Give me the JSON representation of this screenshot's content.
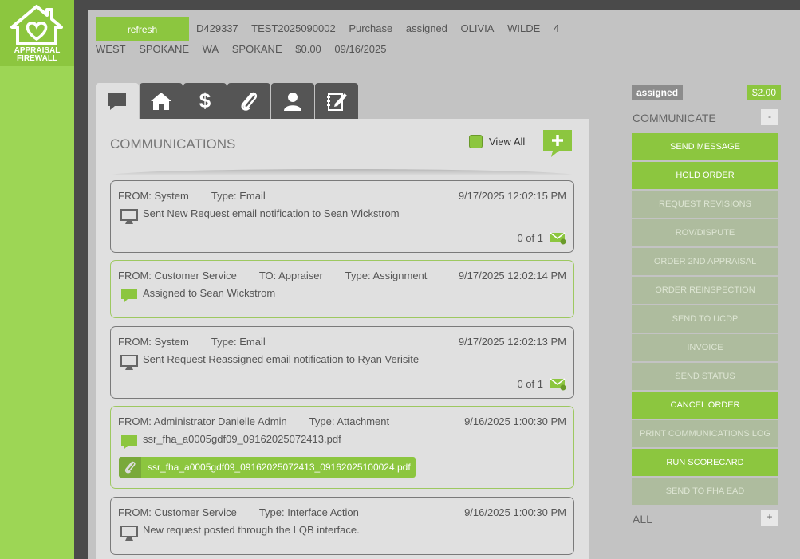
{
  "brand": {
    "line1": "APPRAISAL",
    "line2": "FIREWALL",
    "logo_icon": "house-heart-icon"
  },
  "header": {
    "refresh_label": "refresh",
    "line1": [
      "D429337",
      "TEST2025090002",
      "Purchase",
      "assigned",
      "OLIVIA",
      "WILDE",
      "4"
    ],
    "line2": [
      "WEST",
      "SPOKANE",
      "WA",
      "SPOKANE",
      "$0.00",
      "09/16/2025"
    ]
  },
  "tabs": [
    {
      "name": "tab-communications",
      "icon": "chat-icon"
    },
    {
      "name": "tab-property",
      "icon": "home-icon"
    },
    {
      "name": "tab-billing",
      "icon": "dollar-icon"
    },
    {
      "name": "tab-attachments",
      "icon": "paperclip-icon"
    },
    {
      "name": "tab-contacts",
      "icon": "person-icon"
    },
    {
      "name": "tab-notes",
      "icon": "notepad-icon"
    }
  ],
  "communications": {
    "title": "COMMUNICATIONS",
    "view_all_label": "View All",
    "messages": [
      {
        "from": "FROM: System",
        "to": "",
        "type": "Type: Email",
        "date": "9/17/2025 12:02:15 PM",
        "text": "Sent New Request email notification to Sean Wickstrom",
        "count": "0 of 1",
        "style": "gray",
        "icon": "monitor-icon"
      },
      {
        "from": "FROM: Customer Service",
        "to": "TO: Appraiser",
        "type": "Type: Assignment",
        "date": "9/17/2025 12:02:14 PM",
        "text": "Assigned to Sean Wickstrom",
        "count": "",
        "style": "green",
        "icon": "chat-icon"
      },
      {
        "from": "FROM: System",
        "to": "",
        "type": "Type: Email",
        "date": "9/17/2025 12:02:13 PM",
        "text": "Sent Request Reassigned email notification to Ryan Verisite",
        "count": "0 of 1",
        "style": "gray",
        "icon": "monitor-icon"
      },
      {
        "from": "FROM: Administrator Danielle Admin",
        "to": "",
        "type": "Type: Attachment",
        "date": "9/16/2025 1:00:30 PM",
        "text": "ssr_fha_a0005gdf09_09162025072413.pdf",
        "attachment": "ssr_fha_a0005gdf09_09162025072413_09162025100024.pdf",
        "count": "",
        "style": "green",
        "icon": "chat-icon"
      },
      {
        "from": "FROM: Customer Service",
        "to": "",
        "type": "Type: Interface Action",
        "date": "9/16/2025 1:00:30 PM",
        "text": "New request posted through the LQB interface.",
        "count": "",
        "style": "gray",
        "icon": "monitor-icon"
      }
    ]
  },
  "right_panel": {
    "status": "assigned",
    "price": "$2.00",
    "communicate_title": "COMMUNICATE",
    "communicate_toggle": "-",
    "all_title": "ALL",
    "all_toggle": "+",
    "actions": [
      {
        "label": "SEND MESSAGE",
        "enabled": true
      },
      {
        "label": "HOLD ORDER",
        "enabled": true
      },
      {
        "label": "REQUEST REVISIONS",
        "enabled": false
      },
      {
        "label": "ROV/DISPUTE",
        "enabled": false
      },
      {
        "label": "ORDER 2ND APPRAISAL",
        "enabled": false
      },
      {
        "label": "ORDER REINSPECTION",
        "enabled": false
      },
      {
        "label": "SEND TO UCDP",
        "enabled": false
      },
      {
        "label": "INVOICE",
        "enabled": false
      },
      {
        "label": "SEND STATUS",
        "enabled": false
      },
      {
        "label": "CANCEL ORDER",
        "enabled": true
      },
      {
        "label": "PRINT COMMUNICATIONS LOG",
        "enabled": false
      },
      {
        "label": "RUN SCORECARD",
        "enabled": true
      },
      {
        "label": "SEND TO FHA EAD",
        "enabled": false
      }
    ]
  },
  "colors": {
    "accent": "#8cc63f",
    "sidebar": "#9dd655",
    "disabled": "#aebc9e"
  }
}
